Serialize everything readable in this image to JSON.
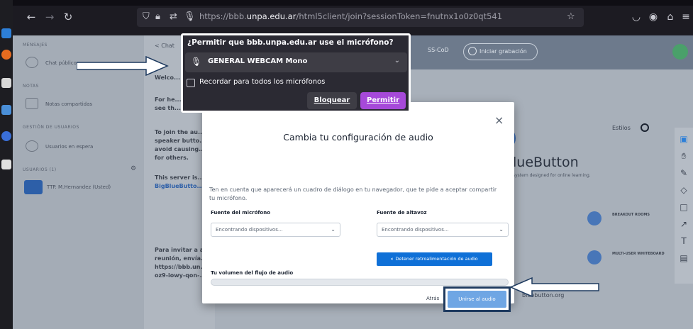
{
  "browser": {
    "url_prefix": "https://bbb.",
    "url_domain": "unpa.edu.ar",
    "url_path": "/html5client/join?sessionToken=fnutnx1o0z0qt541"
  },
  "sidebar": {
    "section_messages": "MENSAJES",
    "chat_public": "Chat público",
    "section_notes": "NOTAS",
    "shared_notes": "Notas compartidas",
    "section_users_mgmt": "GESTIÓN DE USUARIOS",
    "users_group": "Usuarios en espera",
    "section_users": "USUARIOS (1)",
    "user_name": "TTP. M.Hernandez (Usted)"
  },
  "chat": {
    "header": "< Chat",
    "lines": [
      "Welco...",
      "For he...",
      "see th...",
      "To join the au...",
      "speaker butto...",
      "avoid causing...",
      "for others.",
      "This server is...",
      "BigBlueButto...",
      "Para invitar a a...",
      "reunión, envía...",
      "https://bbb.un...",
      "oz9-iowy-qon-..."
    ]
  },
  "app": {
    "rec_label": "Iniciar grabación",
    "sa_label": "SS-CoD",
    "welcome_title": "lueButton",
    "welcome_sub": "system designed for online learning.",
    "status_label": "Estilos",
    "feature_1": "BREAKOUT ROOMS",
    "feature_2": "MULTI-USER WHITEBOARD",
    "bottom_label": "bluebutton.org"
  },
  "permission": {
    "title": "¿Permitir que bbb.unpa.edu.ar use el micrófono?",
    "selected_device": "GENERAL WEBCAM Mono",
    "remember_label": "Recordar para todos los micrófonos",
    "block_label": "Bloquear",
    "allow_label": "Permitir"
  },
  "modal": {
    "title": "Cambia tu configuración de audio",
    "note": "Ten en cuenta que aparecerá un cuadro de diálogo en tu navegador, que te pide a aceptar compartir tu micrófono.",
    "mic_label": "Fuente del micrófono",
    "mic_value": "Encontrando dispositivos...",
    "speaker_label": "Fuente de altavoz",
    "speaker_value": "Encontrando dispositivos...",
    "stop_feedback": "Detener retroalimentación de audio",
    "volume_label": "Tu volumen del flujo de audio",
    "cancel_label": "Atrás",
    "join_label": "Unirse al audio",
    "close_glyph": "×"
  },
  "colors": {
    "allow_purple": "#a649d9",
    "primary_blue": "#0f70d7",
    "join_blue": "#6fa6e4",
    "highlight_navy": "#1e3a5f"
  }
}
